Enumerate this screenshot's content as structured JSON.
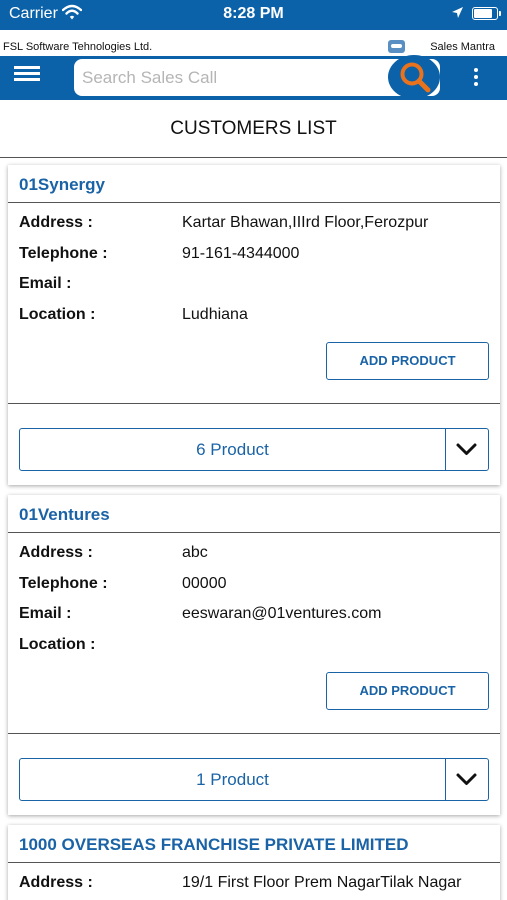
{
  "status_bar": {
    "carrier": "Carrier",
    "time": "8:28 PM"
  },
  "company_bar": {
    "company_name": "FSL Software Tehnologies Ltd.",
    "app_name": "Sales Mantra"
  },
  "toolbar": {
    "search_placeholder": "Search Sales Call",
    "search_value": ""
  },
  "page_title": "CUSTOMERS LIST",
  "field_labels": {
    "address": "Address :",
    "telephone": "Telephone :",
    "email": "Email :",
    "location": "Location :"
  },
  "customers": [
    {
      "name": "01Synergy",
      "address": "Kartar Bhawan,IIIrd Floor,Ferozpur",
      "telephone": "91-161-4344000",
      "email": "",
      "location": "Ludhiana",
      "add_product_label": "ADD PRODUCT",
      "product_count_label": "6 Product"
    },
    {
      "name": "01Ventures",
      "address": "abc",
      "telephone": "00000",
      "email": "eeswaran@01ventures.com",
      "location": "",
      "add_product_label": "ADD PRODUCT",
      "product_count_label": "1 Product"
    },
    {
      "name": "1000 OVERSEAS FRANCHISE PRIVATE LIMITED",
      "address": "19/1 First Floor Prem NagarTilak Nagar"
    }
  ],
  "colors": {
    "brand_blue": "#0b62a9",
    "accent_orange": "#e8731c",
    "link_blue": "#1a63a6"
  },
  "icons": {
    "menu": "hamburger-icon",
    "search": "search-icon",
    "more": "more-vertical-icon",
    "dropdown": "chevron-down-icon",
    "wifi": "wifi-icon",
    "location": "location-arrow-icon",
    "battery": "battery-icon"
  }
}
